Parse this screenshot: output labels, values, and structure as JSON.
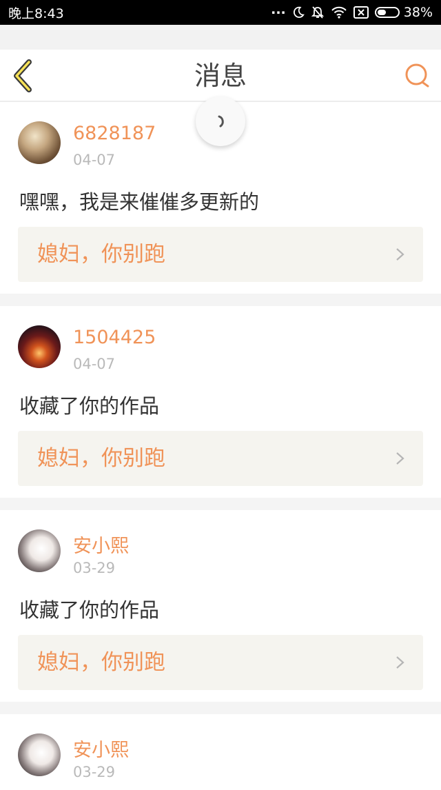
{
  "statusbar": {
    "time": "晚上8:43",
    "dots": "...",
    "battery_percent": "38%",
    "battery_level": 0.38,
    "icons": [
      "moon-icon",
      "bell-off-icon",
      "wifi-icon",
      "sim-x-icon",
      "battery-icon"
    ]
  },
  "navbar": {
    "title": "消息",
    "back_icon": "chevron-left-icon",
    "search_icon": "search-icon"
  },
  "accent_color": "#f09358",
  "messages": [
    {
      "username": "6828187",
      "date": "04-07",
      "text": "嘿嘿，我是来催催多更新的",
      "work": "媳妇，你别跑"
    },
    {
      "username": "1504425",
      "date": "04-07",
      "text": "收藏了你的作品",
      "work": "媳妇，你别跑"
    },
    {
      "username": "安小熙",
      "date": "03-29",
      "text": "收藏了你的作品",
      "work": "媳妇，你别跑"
    },
    {
      "username": "安小熙",
      "date": "03-29"
    }
  ]
}
